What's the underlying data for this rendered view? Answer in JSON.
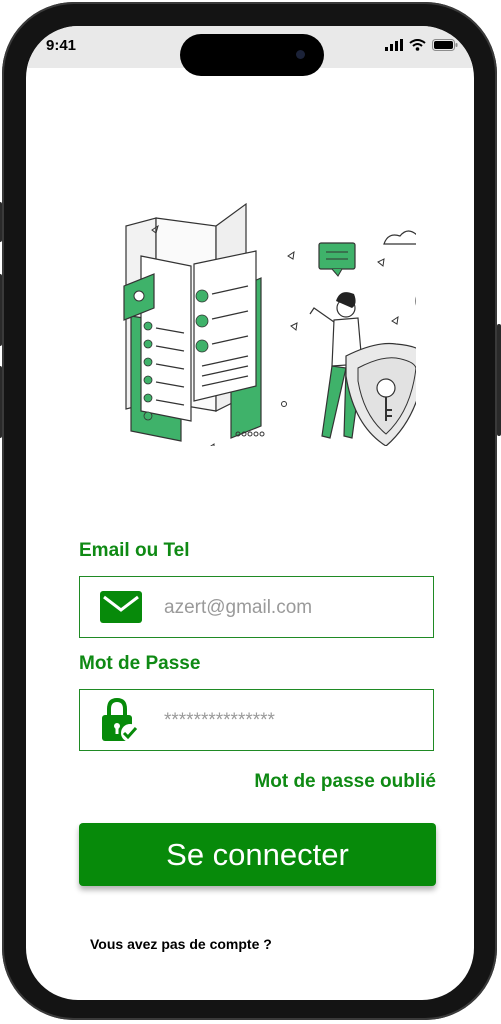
{
  "status_bar": {
    "time": "9:41",
    "icons": [
      "signal-icon",
      "wifi-icon",
      "battery-icon"
    ]
  },
  "illustration": {
    "name": "security-login-illustration"
  },
  "form": {
    "email_label": "Email ou Tel",
    "email_placeholder": "azert@gmail.com",
    "email_icon": "mail-icon",
    "password_label": "Mot de Passe",
    "password_placeholder": "***************",
    "password_icon": "lock-check-icon",
    "forgot_label": "Mot de passe oublié",
    "submit_label": "Se connecter",
    "no_account_text": "Vous avez pas de compte ?"
  },
  "colors": {
    "accent": "#0f8a14",
    "button": "#078a0a",
    "placeholder": "#9a9a9a",
    "illustration_green": "#3fb26a"
  }
}
